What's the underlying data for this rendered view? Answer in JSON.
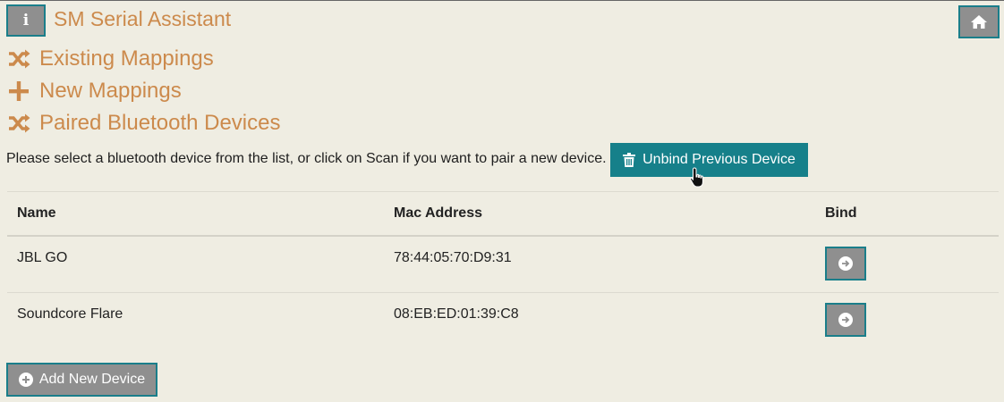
{
  "header": {
    "info_label": "i",
    "title": "SM Serial Assistant"
  },
  "nav": {
    "existing": "Existing Mappings",
    "new": "New Mappings",
    "paired": "Paired Bluetooth Devices"
  },
  "instructions": "Please select a bluetooth device from the list, or click on Scan if you want to pair a new device.",
  "unbind_label": "Unbind Previous Device",
  "table": {
    "headers": [
      "Name",
      "Mac Address",
      "Bind"
    ],
    "rows": [
      {
        "name": "JBL GO",
        "mac": "78:44:05:70:D9:31"
      },
      {
        "name": "Soundcore Flare",
        "mac": "08:EB:ED:01:39:C8"
      }
    ]
  },
  "add_label": "Add New Device",
  "colors": {
    "background": "#efede2",
    "accent": "#cc8a4c",
    "teal": "#16808a",
    "button_gray": "#8f8f8f"
  }
}
